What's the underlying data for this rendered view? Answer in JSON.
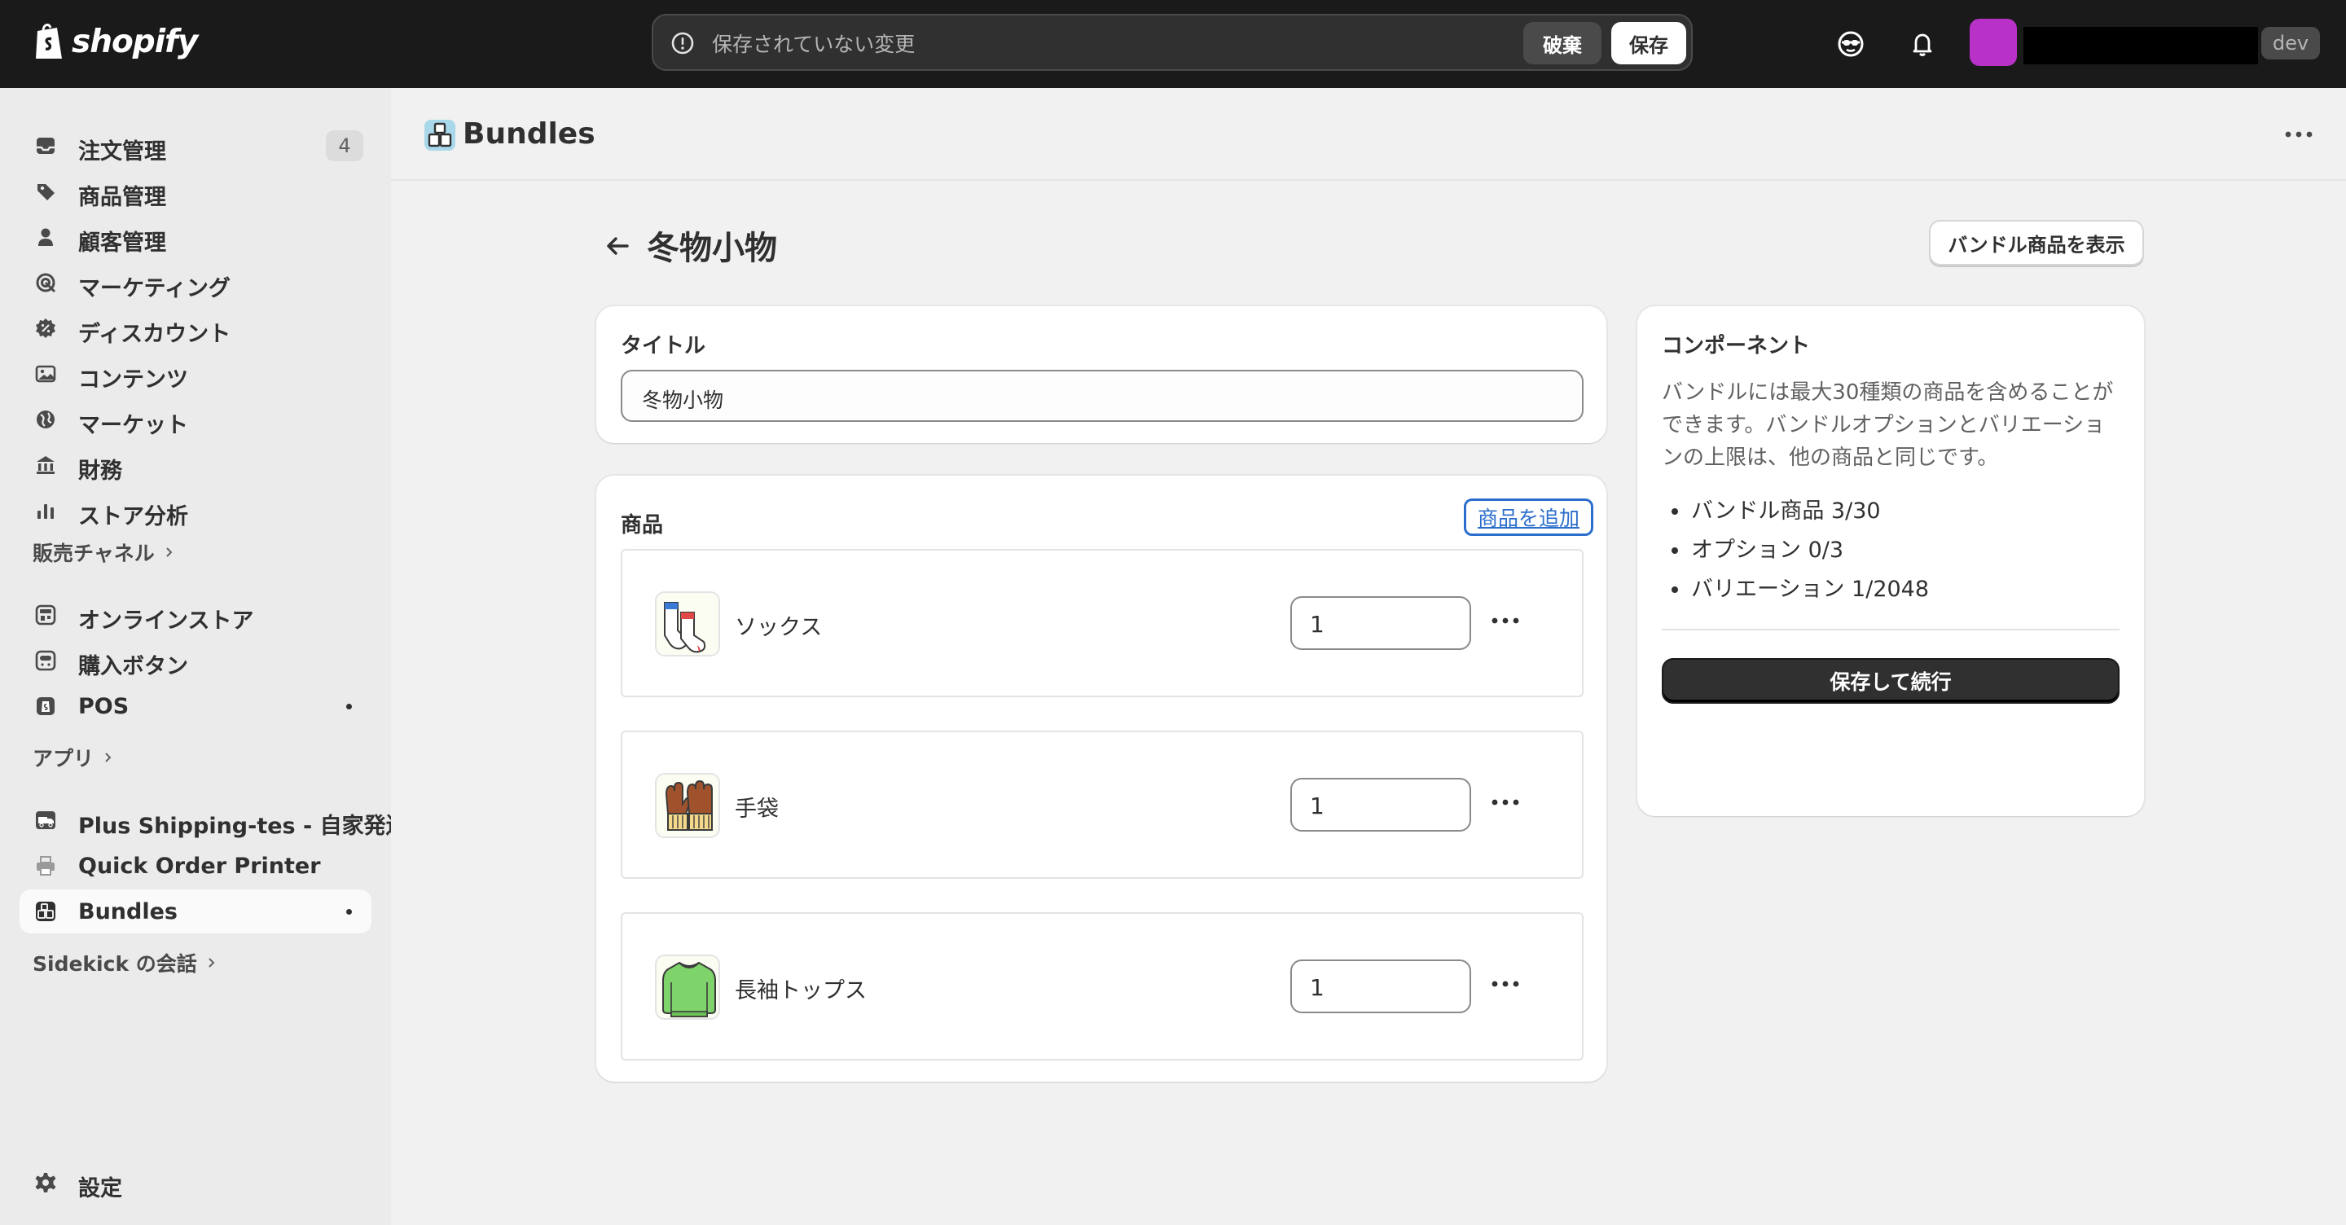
{
  "topbar": {
    "brand": "shopify",
    "unsaved_message": "保存されていない変更",
    "discard_label": "破棄",
    "save_label": "保存",
    "store_badge": "dev"
  },
  "sidebar": {
    "items": [
      {
        "label": "注文管理",
        "icon": "inbox-icon",
        "badge": "4"
      },
      {
        "label": "商品管理",
        "icon": "tag-icon"
      },
      {
        "label": "顧客管理",
        "icon": "person-icon"
      },
      {
        "label": "マーケティング",
        "icon": "target-icon"
      },
      {
        "label": "ディスカウント",
        "icon": "discount-icon"
      },
      {
        "label": "コンテンツ",
        "icon": "image-icon"
      },
      {
        "label": "マーケット",
        "icon": "globe-icon"
      },
      {
        "label": "財務",
        "icon": "bank-icon"
      },
      {
        "label": "ストア分析",
        "icon": "chart-icon"
      }
    ],
    "sales_channels_heading": "販売チャネル",
    "sales_channels": [
      {
        "label": "オンラインストア",
        "icon": "store-icon"
      },
      {
        "label": "購入ボタン",
        "icon": "buy-button-icon"
      },
      {
        "label": "POS",
        "icon": "pos-icon"
      }
    ],
    "apps_heading": "アプリ",
    "apps": [
      {
        "label": "Plus Shipping-tes - 自家発送",
        "icon": "truck-app-icon"
      },
      {
        "label": "Quick Order Printer",
        "icon": "printer-app-icon"
      },
      {
        "label": "Bundles",
        "icon": "bundles-app-icon"
      }
    ],
    "sidekick_heading": "Sidekick の会話",
    "settings_label": "設定"
  },
  "app_header": {
    "title": "Bundles"
  },
  "page": {
    "title": "冬物小物",
    "view_bundle_label": "バンドル商品を表示"
  },
  "title_card": {
    "label": "タイトル",
    "value": "冬物小物"
  },
  "products_card": {
    "label": "商品",
    "add_label": "商品を追加",
    "items": [
      {
        "name": "ソックス",
        "quantity": "1",
        "icon": "socks-icon"
      },
      {
        "name": "手袋",
        "quantity": "1",
        "icon": "gloves-icon"
      },
      {
        "name": "長袖トップス",
        "quantity": "1",
        "icon": "sweater-icon"
      }
    ]
  },
  "components_card": {
    "title": "コンポーネント",
    "description": "バンドルには最大30種類の商品を含めることができます。バンドルオプションとバリエーションの上限は、他の商品と同じです。",
    "stats": [
      "バンドル商品 3/30",
      "オプション 0/3",
      "バリエーション 1/2048"
    ],
    "save_continue_label": "保存して続行"
  }
}
